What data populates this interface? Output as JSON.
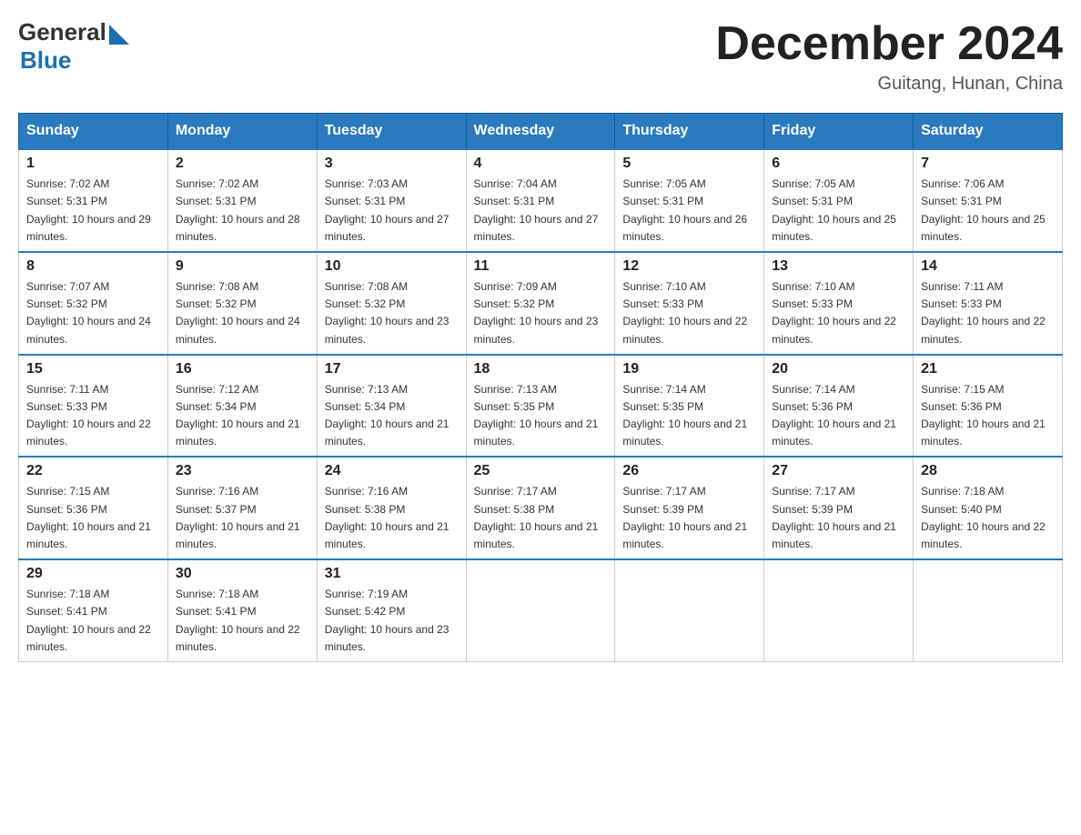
{
  "header": {
    "logo": {
      "general": "General",
      "blue": "Blue"
    },
    "title": "December 2024",
    "subtitle": "Guitang, Hunan, China"
  },
  "calendar": {
    "days_of_week": [
      "Sunday",
      "Monday",
      "Tuesday",
      "Wednesday",
      "Thursday",
      "Friday",
      "Saturday"
    ],
    "weeks": [
      [
        {
          "day": "1",
          "sunrise": "Sunrise: 7:02 AM",
          "sunset": "Sunset: 5:31 PM",
          "daylight": "Daylight: 10 hours and 29 minutes."
        },
        {
          "day": "2",
          "sunrise": "Sunrise: 7:02 AM",
          "sunset": "Sunset: 5:31 PM",
          "daylight": "Daylight: 10 hours and 28 minutes."
        },
        {
          "day": "3",
          "sunrise": "Sunrise: 7:03 AM",
          "sunset": "Sunset: 5:31 PM",
          "daylight": "Daylight: 10 hours and 27 minutes."
        },
        {
          "day": "4",
          "sunrise": "Sunrise: 7:04 AM",
          "sunset": "Sunset: 5:31 PM",
          "daylight": "Daylight: 10 hours and 27 minutes."
        },
        {
          "day": "5",
          "sunrise": "Sunrise: 7:05 AM",
          "sunset": "Sunset: 5:31 PM",
          "daylight": "Daylight: 10 hours and 26 minutes."
        },
        {
          "day": "6",
          "sunrise": "Sunrise: 7:05 AM",
          "sunset": "Sunset: 5:31 PM",
          "daylight": "Daylight: 10 hours and 25 minutes."
        },
        {
          "day": "7",
          "sunrise": "Sunrise: 7:06 AM",
          "sunset": "Sunset: 5:31 PM",
          "daylight": "Daylight: 10 hours and 25 minutes."
        }
      ],
      [
        {
          "day": "8",
          "sunrise": "Sunrise: 7:07 AM",
          "sunset": "Sunset: 5:32 PM",
          "daylight": "Daylight: 10 hours and 24 minutes."
        },
        {
          "day": "9",
          "sunrise": "Sunrise: 7:08 AM",
          "sunset": "Sunset: 5:32 PM",
          "daylight": "Daylight: 10 hours and 24 minutes."
        },
        {
          "day": "10",
          "sunrise": "Sunrise: 7:08 AM",
          "sunset": "Sunset: 5:32 PM",
          "daylight": "Daylight: 10 hours and 23 minutes."
        },
        {
          "day": "11",
          "sunrise": "Sunrise: 7:09 AM",
          "sunset": "Sunset: 5:32 PM",
          "daylight": "Daylight: 10 hours and 23 minutes."
        },
        {
          "day": "12",
          "sunrise": "Sunrise: 7:10 AM",
          "sunset": "Sunset: 5:33 PM",
          "daylight": "Daylight: 10 hours and 22 minutes."
        },
        {
          "day": "13",
          "sunrise": "Sunrise: 7:10 AM",
          "sunset": "Sunset: 5:33 PM",
          "daylight": "Daylight: 10 hours and 22 minutes."
        },
        {
          "day": "14",
          "sunrise": "Sunrise: 7:11 AM",
          "sunset": "Sunset: 5:33 PM",
          "daylight": "Daylight: 10 hours and 22 minutes."
        }
      ],
      [
        {
          "day": "15",
          "sunrise": "Sunrise: 7:11 AM",
          "sunset": "Sunset: 5:33 PM",
          "daylight": "Daylight: 10 hours and 22 minutes."
        },
        {
          "day": "16",
          "sunrise": "Sunrise: 7:12 AM",
          "sunset": "Sunset: 5:34 PM",
          "daylight": "Daylight: 10 hours and 21 minutes."
        },
        {
          "day": "17",
          "sunrise": "Sunrise: 7:13 AM",
          "sunset": "Sunset: 5:34 PM",
          "daylight": "Daylight: 10 hours and 21 minutes."
        },
        {
          "day": "18",
          "sunrise": "Sunrise: 7:13 AM",
          "sunset": "Sunset: 5:35 PM",
          "daylight": "Daylight: 10 hours and 21 minutes."
        },
        {
          "day": "19",
          "sunrise": "Sunrise: 7:14 AM",
          "sunset": "Sunset: 5:35 PM",
          "daylight": "Daylight: 10 hours and 21 minutes."
        },
        {
          "day": "20",
          "sunrise": "Sunrise: 7:14 AM",
          "sunset": "Sunset: 5:36 PM",
          "daylight": "Daylight: 10 hours and 21 minutes."
        },
        {
          "day": "21",
          "sunrise": "Sunrise: 7:15 AM",
          "sunset": "Sunset: 5:36 PM",
          "daylight": "Daylight: 10 hours and 21 minutes."
        }
      ],
      [
        {
          "day": "22",
          "sunrise": "Sunrise: 7:15 AM",
          "sunset": "Sunset: 5:36 PM",
          "daylight": "Daylight: 10 hours and 21 minutes."
        },
        {
          "day": "23",
          "sunrise": "Sunrise: 7:16 AM",
          "sunset": "Sunset: 5:37 PM",
          "daylight": "Daylight: 10 hours and 21 minutes."
        },
        {
          "day": "24",
          "sunrise": "Sunrise: 7:16 AM",
          "sunset": "Sunset: 5:38 PM",
          "daylight": "Daylight: 10 hours and 21 minutes."
        },
        {
          "day": "25",
          "sunrise": "Sunrise: 7:17 AM",
          "sunset": "Sunset: 5:38 PM",
          "daylight": "Daylight: 10 hours and 21 minutes."
        },
        {
          "day": "26",
          "sunrise": "Sunrise: 7:17 AM",
          "sunset": "Sunset: 5:39 PM",
          "daylight": "Daylight: 10 hours and 21 minutes."
        },
        {
          "day": "27",
          "sunrise": "Sunrise: 7:17 AM",
          "sunset": "Sunset: 5:39 PM",
          "daylight": "Daylight: 10 hours and 21 minutes."
        },
        {
          "day": "28",
          "sunrise": "Sunrise: 7:18 AM",
          "sunset": "Sunset: 5:40 PM",
          "daylight": "Daylight: 10 hours and 22 minutes."
        }
      ],
      [
        {
          "day": "29",
          "sunrise": "Sunrise: 7:18 AM",
          "sunset": "Sunset: 5:41 PM",
          "daylight": "Daylight: 10 hours and 22 minutes."
        },
        {
          "day": "30",
          "sunrise": "Sunrise: 7:18 AM",
          "sunset": "Sunset: 5:41 PM",
          "daylight": "Daylight: 10 hours and 22 minutes."
        },
        {
          "day": "31",
          "sunrise": "Sunrise: 7:19 AM",
          "sunset": "Sunset: 5:42 PM",
          "daylight": "Daylight: 10 hours and 23 minutes."
        },
        null,
        null,
        null,
        null
      ]
    ]
  }
}
